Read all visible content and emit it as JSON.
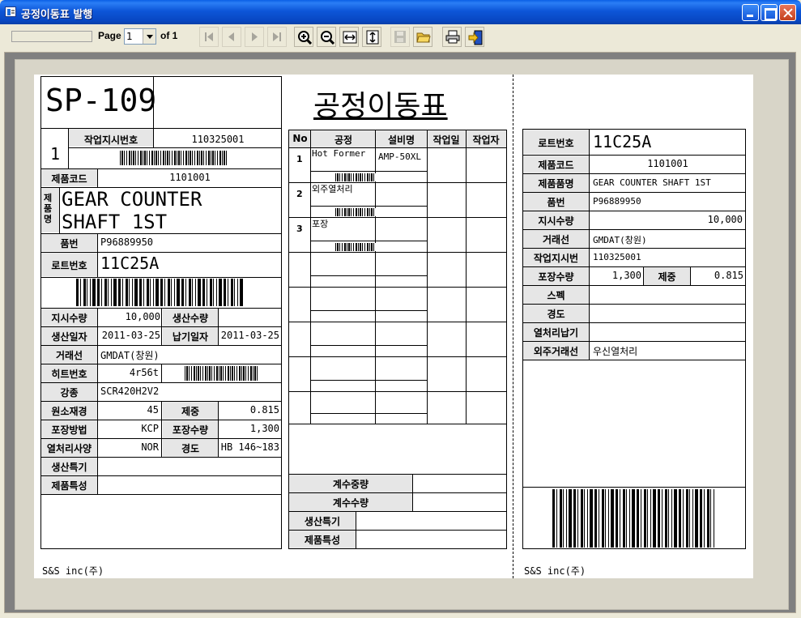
{
  "window": {
    "title": "공정이동표 발행"
  },
  "toolbar": {
    "page_label": "Page",
    "page_value": "1",
    "of_label": "of 1"
  },
  "form": {
    "title": "공정이동표",
    "sp_code": "SP-109",
    "seq": "1",
    "work_order_label": "작업지시번호",
    "work_order_no": "110325001",
    "product_code_label": "제품코드",
    "product_code": "1101001",
    "product_name_label": "제품명",
    "product_name_line1": "GEAR COUNTER",
    "product_name_line2": "SHAFT 1ST",
    "part_no_label": "품번",
    "part_no": "P96889950",
    "lot_label": "로트번호",
    "lot_no": "11C25A",
    "order_qty_label": "지시수량",
    "order_qty": "10,000",
    "prod_qty_label": "생산수량",
    "prod_qty": "",
    "prod_date_label": "생산일자",
    "prod_date": "2011-03-25",
    "due_date_label": "납기일자",
    "due_date": "2011-03-25",
    "customer_label": "거래선",
    "customer": "GMDAT(창원)",
    "heat_label": "히트번호",
    "heat_no": "4r56t",
    "steel_label": "강종",
    "steel": "SCR420H2V2",
    "material_label": "원소재경",
    "material_dia": "45",
    "weight_label": "제중",
    "weight": "0.815",
    "pack_method_label": "포장방법",
    "pack_method": "KCP",
    "pack_qty_label": "포장수량",
    "pack_qty": "1,300",
    "heat_spec_label": "열처리사양",
    "heat_spec": "NOR",
    "hardness_label": "경도",
    "hardness": "HB 146~183",
    "prod_note_label": "생산특기",
    "prod_note": "",
    "product_note_label": "제품특성",
    "product_note": "",
    "footer": "S&S inc(주)"
  },
  "process": {
    "headers": [
      "No",
      "공정",
      "설비명",
      "작업일",
      "작업자"
    ],
    "rows": [
      {
        "no": "1",
        "process": "Hot Former",
        "equipment": "AMP-50XL"
      },
      {
        "no": "2",
        "process": "외주열처리",
        "equipment": ""
      },
      {
        "no": "3",
        "process": "포장",
        "equipment": ""
      }
    ],
    "weigh_weight_label": "계수중량",
    "weigh_weight": "",
    "weigh_qty_label": "계수수량",
    "weigh_qty": "",
    "prod_note_label": "생산특기",
    "prod_note": "",
    "product_note_label": "제품특성",
    "product_note": ""
  },
  "tag": {
    "lot_label": "로트번호",
    "lot_no": "11C25A",
    "product_code_label": "제품코드",
    "product_code": "1101001",
    "product_name_label": "제품품명",
    "product_name": "GEAR COUNTER SHAFT 1ST",
    "part_no_label": "품번",
    "part_no": "P96889950",
    "order_qty_label": "지시수량",
    "order_qty": "10,000",
    "customer_label": "거래선",
    "customer": "GMDAT(창원)",
    "work_order_label": "작업지시번",
    "work_order": "110325001",
    "pack_qty_label": "포장수량",
    "pack_qty": "1,300",
    "weight_label": "제중",
    "weight": "0.815",
    "spec_label": "스펙",
    "spec": "",
    "hardness_label": "경도",
    "hardness": "",
    "heat_due_label": "열처리납기",
    "heat_due": "",
    "vendor_label": "외주거래선",
    "vendor": "우신열처리",
    "footer": "S&S inc(주)"
  }
}
